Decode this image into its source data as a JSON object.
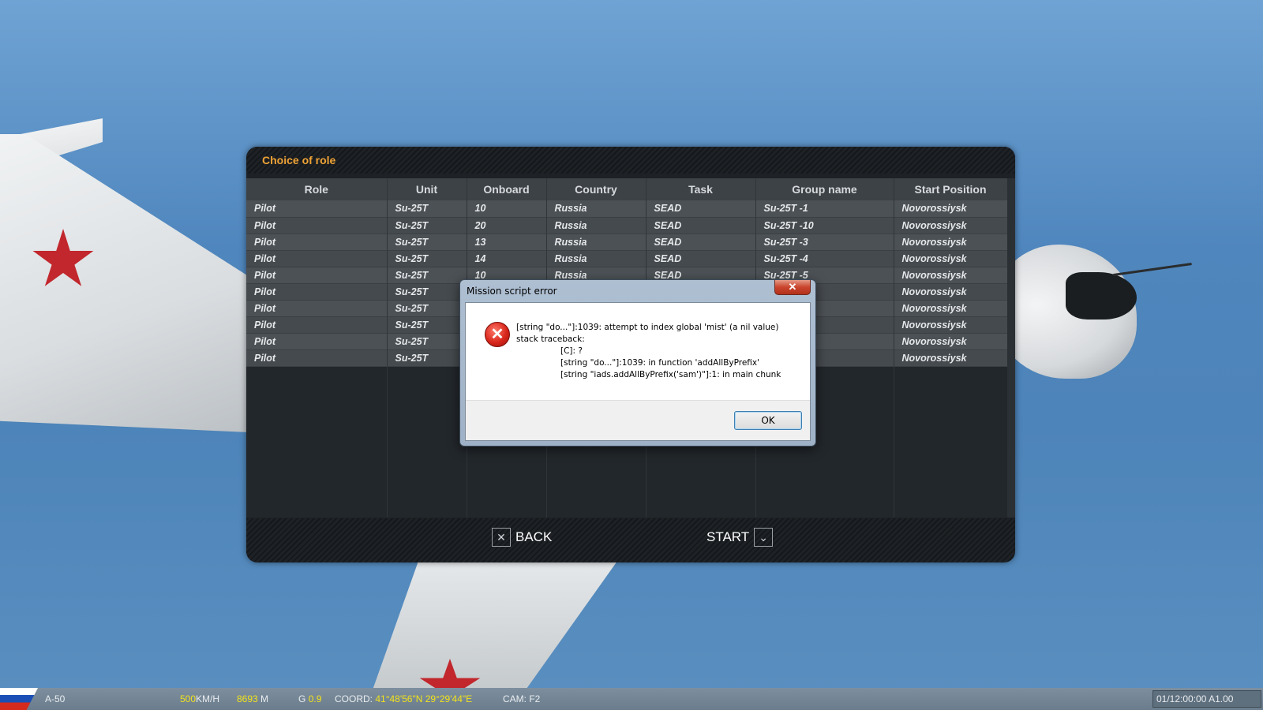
{
  "panel": {
    "title": "Choice of role",
    "columns": [
      "Role",
      "Unit",
      "Onboard",
      "Country",
      "Task",
      "Group name",
      "Start Position"
    ],
    "rows": [
      [
        "Pilot",
        "Su-25T",
        "10",
        "Russia",
        "SEAD",
        "Su-25T -1",
        "Novorossiysk"
      ],
      [
        "Pilot",
        "Su-25T",
        "20",
        "Russia",
        "SEAD",
        "Su-25T -10",
        "Novorossiysk"
      ],
      [
        "Pilot",
        "Su-25T",
        "13",
        "Russia",
        "SEAD",
        "Su-25T -3",
        "Novorossiysk"
      ],
      [
        "Pilot",
        "Su-25T",
        "14",
        "Russia",
        "SEAD",
        "Su-25T -4",
        "Novorossiysk"
      ],
      [
        "Pilot",
        "Su-25T",
        "10",
        "Russia",
        "SEAD",
        "Su-25T -5",
        "Novorossiysk"
      ],
      [
        "Pilot",
        "Su-25T",
        "",
        "",
        "",
        "",
        "Novorossiysk"
      ],
      [
        "Pilot",
        "Su-25T",
        "",
        "",
        "",
        "",
        "Novorossiysk"
      ],
      [
        "Pilot",
        "Su-25T",
        "",
        "",
        "",
        "",
        "Novorossiysk"
      ],
      [
        "Pilot",
        "Su-25T",
        "",
        "",
        "",
        "",
        "Novorossiysk"
      ],
      [
        "Pilot",
        "Su-25T",
        "",
        "",
        "",
        "",
        "Novorossiysk"
      ]
    ],
    "back_label": "BACK",
    "start_label": "START"
  },
  "dialog": {
    "title": "Mission script error",
    "close_glyph": "✕",
    "lines": [
      "[string \"do...\"]:1039: attempt to index global 'mist' (a nil value)",
      "stack traceback:"
    ],
    "trace": [
      "[C]: ?",
      "[string \"do...\"]:1039: in function 'addAllByPrefix'",
      "[string \"iads.addAllByPrefix('sam')\"]:1: in main chunk"
    ],
    "ok_label": "OK"
  },
  "status": {
    "aircraft": "A-50",
    "speed_value": "500",
    "speed_unit": "KM/H",
    "alt_value": "8693",
    "alt_unit": "M",
    "g_label": "G",
    "g_value": "0.9",
    "coord_label": "COORD:",
    "coord_value": "41°48'56\"N 29°29'44\"E",
    "cam_label": "CAM:",
    "cam_value": "F2",
    "time": "01/12:00:00 A1.00"
  },
  "colors": {
    "title_accent": "#f0a336",
    "status_highlight": "#f3e21a",
    "error_red": "#d8261b"
  }
}
